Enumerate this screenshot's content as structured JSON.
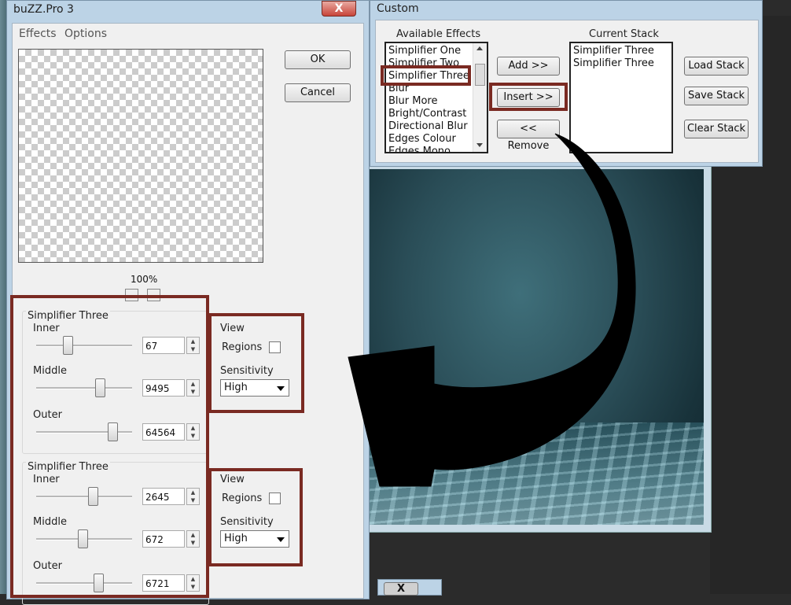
{
  "main_dialog": {
    "title": "buZZ.Pro 3",
    "close_glyph": "X",
    "menu": [
      "Effects",
      "Options"
    ],
    "ok_label": "OK",
    "cancel_label": "Cancel",
    "zoom": "100%",
    "effects": [
      {
        "name": "Simplifier Three",
        "sliders": [
          {
            "label": "Inner",
            "value": "67"
          },
          {
            "label": "Middle",
            "value": "9495"
          },
          {
            "label": "Outer",
            "value": "64564"
          }
        ],
        "view_label": "View",
        "regions_label": "Regions",
        "regions_checked": false,
        "sensitivity_label": "Sensitivity",
        "sensitivity_value": "High"
      },
      {
        "name": "Simplifier Three",
        "sliders": [
          {
            "label": "Inner",
            "value": "2645"
          },
          {
            "label": "Middle",
            "value": "672"
          },
          {
            "label": "Outer",
            "value": "6721"
          }
        ],
        "view_label": "View",
        "regions_label": "Regions",
        "regions_checked": false,
        "sensitivity_label": "Sensitivity",
        "sensitivity_value": "High"
      }
    ]
  },
  "custom_dialog": {
    "title": "Custom",
    "available_label": "Available Effects",
    "available_items": [
      "Simplifier One",
      "Simplifier Two",
      "Simplifier Three",
      "Blur",
      "Blur More",
      "Bright/Contrast",
      "Directional Blur",
      "Edges Colour",
      "Edges Mono"
    ],
    "selected_index": 2,
    "stack_label": "Current Stack",
    "stack_items": [
      "Simplifier Three",
      "Simplifier Three"
    ],
    "add_label": "Add >>",
    "insert_label": "Insert >>",
    "remove_label": "<< Remove",
    "load_label": "Load Stack",
    "save_label": "Save Stack",
    "clear_label": "Clear Stack"
  },
  "colors": {
    "annotation_red": "#7a2a22",
    "arrow": "#000000"
  }
}
